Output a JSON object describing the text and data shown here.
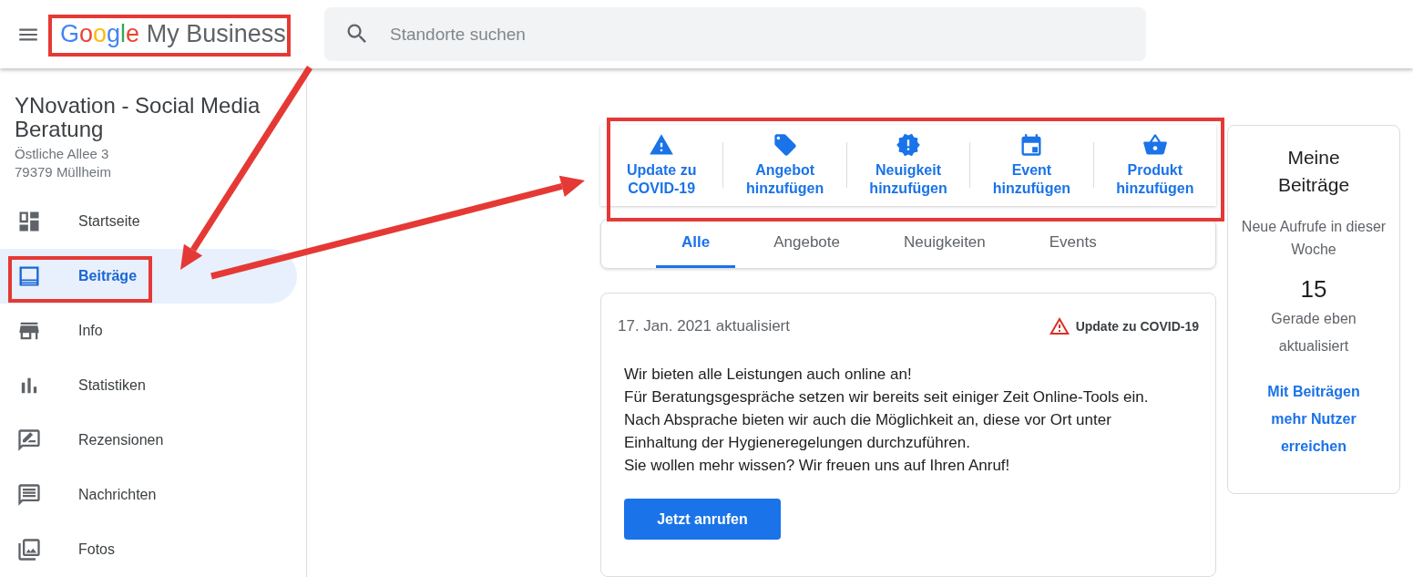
{
  "header": {
    "logo": {
      "brand": "Google",
      "product": "My Business"
    },
    "search": {
      "placeholder": "Standorte suchen"
    }
  },
  "business": {
    "name": "YNovation - Social Media Beratung",
    "address_lines": [
      "Östliche Allee 3",
      "79379 Müllheim"
    ]
  },
  "sidebar": {
    "items": [
      {
        "label": "Startseite",
        "kind": "dashboard",
        "selected": false
      },
      {
        "label": "Beiträge",
        "kind": "posts",
        "selected": true
      },
      {
        "label": "Info",
        "kind": "store",
        "selected": false
      },
      {
        "label": "Statistiken",
        "kind": "chart",
        "selected": false
      },
      {
        "label": "Rezensionen",
        "kind": "review",
        "selected": false
      },
      {
        "label": "Nachrichten",
        "kind": "chat",
        "selected": false
      },
      {
        "label": "Fotos",
        "kind": "photos",
        "selected": false
      }
    ]
  },
  "actions": [
    {
      "label": "Update zu COVID-19",
      "kind": "warning"
    },
    {
      "label": "Angebot hinzufügen",
      "kind": "offer"
    },
    {
      "label": "Neuigkeit hinzufügen",
      "kind": "news"
    },
    {
      "label": "Event hinzufügen",
      "kind": "event"
    },
    {
      "label": "Produkt hinzufügen",
      "kind": "product"
    }
  ],
  "tabs": [
    {
      "label": "Alle",
      "selected": true
    },
    {
      "label": "Angebote",
      "selected": false
    },
    {
      "label": "Neuigkeiten",
      "selected": false
    },
    {
      "label": "Events",
      "selected": false
    }
  ],
  "post": {
    "date": "17. Jan. 2021 aktualisiert",
    "type_label": "Update zu COVID-19",
    "text": "Wir bieten alle Leistungen auch online an!\nFür Beratungsgespräche setzen wir bereits seit einiger Zeit Online-Tools ein.\nNach Absprache bieten wir auch die Möglichkeit an, diese vor Ort unter\nEinhaltung der Hygieneregelungen durchzuführen.\nSie wollen mehr wissen? Wir freuen uns auf Ihren Anruf!",
    "button": "Jetzt anrufen"
  },
  "stats": {
    "title": "Meine Beiträge",
    "subtitle": "Neue Aufrufe in dieser Woche",
    "count": "15",
    "status": "Gerade eben aktualisiert",
    "link": "Mit Beiträgen mehr Nutzer erreichen"
  }
}
